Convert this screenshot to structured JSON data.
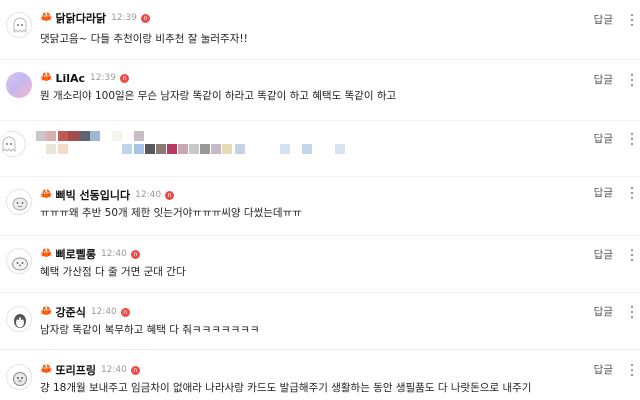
{
  "comments": [
    {
      "nickname": "닭닭다라닭",
      "time": "12:39",
      "badge": "n",
      "text": "댓닭고음~ 다들 추천이랑 비추천 잘 눌러주자!!",
      "reply": "답글",
      "avatar_icon": "ghost-icon"
    },
    {
      "nickname": "LilAc",
      "time": "12:39",
      "badge": "n",
      "text": "뭔 개소리야 100일은 무슨 남자랑 똑같이 하라고 똑같이 하고 혜택도 똑같이 하고",
      "reply": "답글",
      "avatar_icon": "gradient-avatar-icon"
    },
    {
      "nickname": "",
      "time": "",
      "badge": "",
      "text": "",
      "reply": "답글",
      "avatar_icon": "ghost-icon"
    },
    {
      "nickname": "삐빅 선동입니다",
      "time": "12:40",
      "badge": "n",
      "text": "ㅠㅠㅠ왜 추반 50개 제한 잇는거야ㅠㅠㅠ씨양 다썼는데ㅠㅠ",
      "reply": "답글",
      "avatar_icon": "blob-icon"
    },
    {
      "nickname": "삐로삘롱",
      "time": "12:40",
      "badge": "n",
      "text": "혜택 가산점 다 줄 거면 군대 간다",
      "reply": "답글",
      "avatar_icon": "seal-icon"
    },
    {
      "nickname": "강준식",
      "time": "12:40",
      "badge": "n",
      "text": "남자랑 똑같이 복무하고 혜택 다 줘ㅋㅋㅋㅋㅋㅋㅋ",
      "reply": "답글",
      "avatar_icon": "penguin-icon"
    },
    {
      "nickname": "또리프링",
      "time": "12:40",
      "badge": "n",
      "text": "걍 18개월 보내주고 임금차이 없애라 나라사랑 카드도 발급해주기 생활하는 동안 생필품도 다 나랏돈으로 내주기",
      "reply": "답글",
      "avatar_icon": "hedgehog-icon"
    }
  ],
  "colors": {
    "accent_red": "#ee4b47",
    "crab_red": "#e2362b",
    "divider": "#efefef"
  }
}
